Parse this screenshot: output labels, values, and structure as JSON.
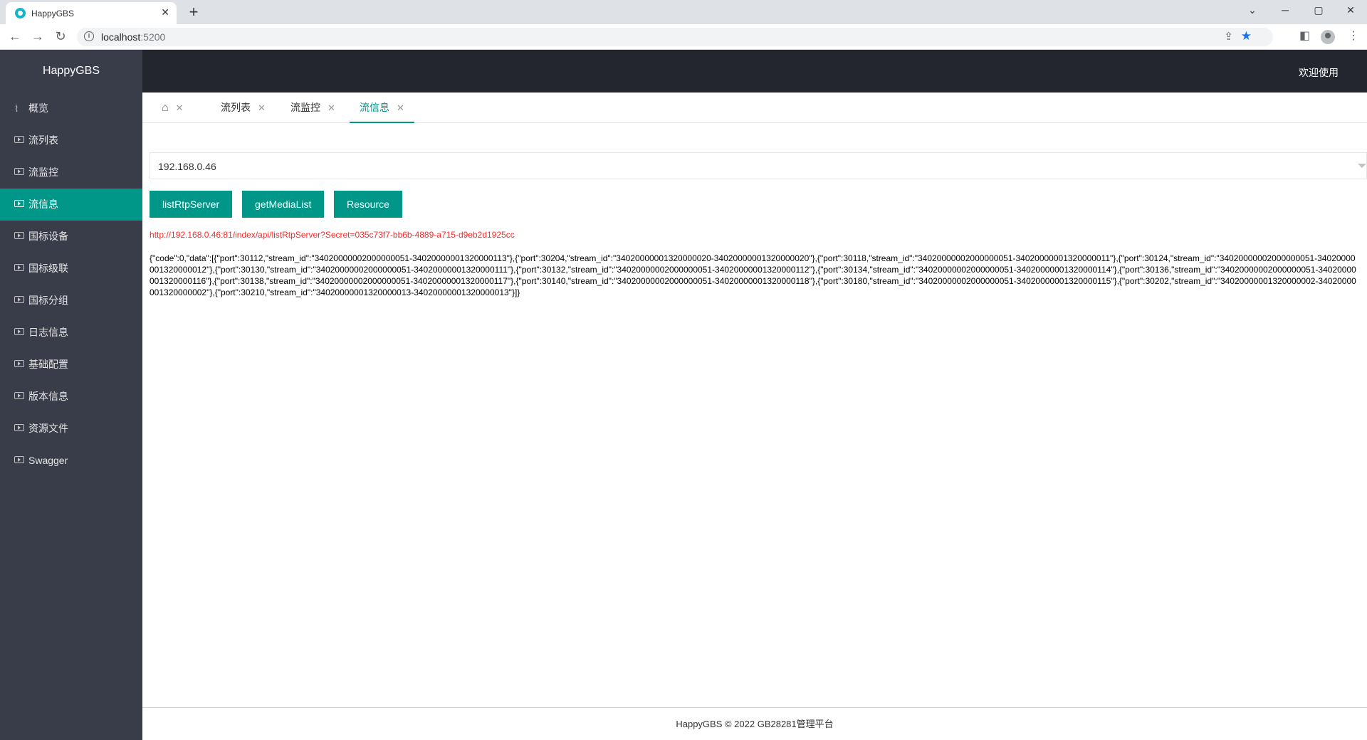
{
  "browser": {
    "tab_title": "HappyGBS",
    "tab_close": "✕",
    "new_tab": "+",
    "url_host": "localhost",
    "url_port": ":5200",
    "win_min": "─",
    "win_max": "▢",
    "win_close": "✕",
    "chevron": "⌄"
  },
  "app": {
    "logo": "HappyGBS",
    "welcome": "欢迎使用"
  },
  "sidebar": {
    "items": [
      {
        "label": "概览"
      },
      {
        "label": "流列表"
      },
      {
        "label": "流监控"
      },
      {
        "label": "流信息"
      },
      {
        "label": "国标设备"
      },
      {
        "label": "国标级联"
      },
      {
        "label": "国标分组"
      },
      {
        "label": "日志信息"
      },
      {
        "label": "基础配置"
      },
      {
        "label": "版本信息"
      },
      {
        "label": "资源文件"
      },
      {
        "label": "Swagger"
      }
    ]
  },
  "page_tabs": {
    "home_close": "✕",
    "tabs": [
      {
        "label": "流列表",
        "close": "✕"
      },
      {
        "label": "流监控",
        "close": "✕"
      },
      {
        "label": "流信息",
        "close": "✕"
      }
    ]
  },
  "main": {
    "server_select": "192.168.0.46",
    "buttons": {
      "list_rtp": "listRtpServer",
      "get_media": "getMediaList",
      "resource": "Resource"
    },
    "api_url": "http://192.168.0.46:81/index/api/listRtpServer?Secret=035c73f7-bb6b-4889-a715-d9eb2d1925cc",
    "result": "{\"code\":0,\"data\":[{\"port\":30112,\"stream_id\":\"34020000002000000051-34020000001320000113\"},{\"port\":30204,\"stream_id\":\"34020000001320000020-34020000001320000020\"},{\"port\":30118,\"stream_id\":\"34020000002000000051-34020000001320000011\"},{\"port\":30124,\"stream_id\":\"34020000002000000051-34020000001320000012\"},{\"port\":30130,\"stream_id\":\"34020000002000000051-34020000001320000111\"},{\"port\":30132,\"stream_id\":\"34020000002000000051-34020000001320000112\"},{\"port\":30134,\"stream_id\":\"34020000002000000051-34020000001320000114\"},{\"port\":30136,\"stream_id\":\"34020000002000000051-34020000001320000116\"},{\"port\":30138,\"stream_id\":\"34020000002000000051-34020000001320000117\"},{\"port\":30140,\"stream_id\":\"34020000002000000051-34020000001320000118\"},{\"port\":30180,\"stream_id\":\"34020000002000000051-34020000001320000115\"},{\"port\":30202,\"stream_id\":\"34020000001320000002-34020000001320000002\"},{\"port\":30210,\"stream_id\":\"34020000001320000013-34020000001320000013\"}]}"
  },
  "footer": {
    "text": "HappyGBS © 2022 GB28281管理平台"
  },
  "colors": {
    "accent": "#009688",
    "sidebar_bg": "#393d49",
    "header_bg": "#23262e",
    "url_text": "#ff2a2a"
  },
  "icons": [
    "home-icon",
    "pulse-icon",
    "play-square-icon",
    "close-icon",
    "star-icon",
    "share-icon",
    "info-icon",
    "back-arrow-icon",
    "forward-arrow-icon",
    "reload-icon"
  ]
}
